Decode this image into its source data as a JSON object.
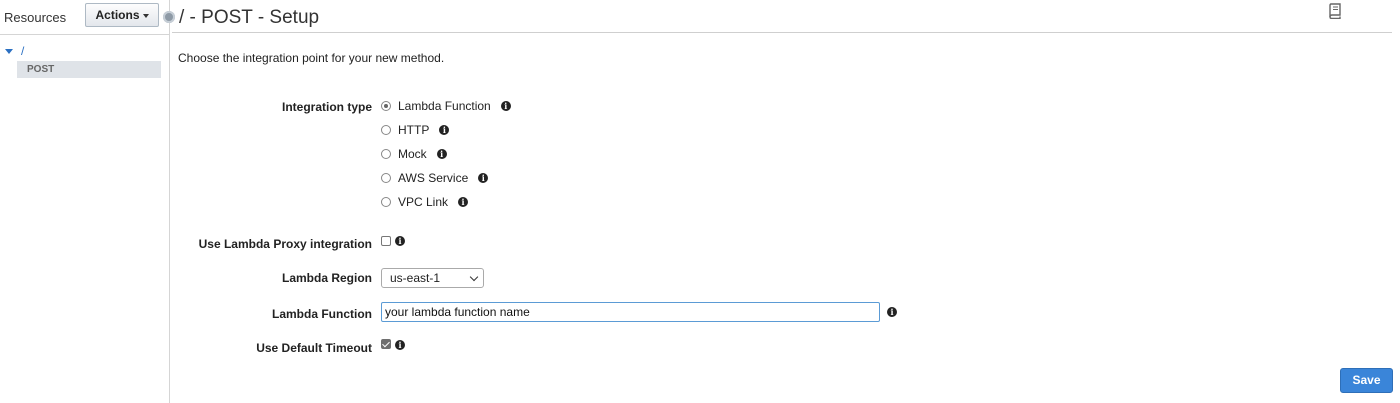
{
  "sidebar": {
    "title": "Resources",
    "actions_label": "Actions",
    "tree": {
      "root_label": "/",
      "child_label": "POST"
    }
  },
  "header": {
    "title": "/ - POST - Setup"
  },
  "main": {
    "intro": "Choose the integration point for your new method.",
    "integration_type": {
      "label": "Integration type",
      "selected": "Lambda Function",
      "options": [
        {
          "label": "Lambda Function"
        },
        {
          "label": "HTTP"
        },
        {
          "label": "Mock"
        },
        {
          "label": "AWS Service"
        },
        {
          "label": "VPC Link"
        }
      ]
    },
    "proxy": {
      "label": "Use Lambda Proxy integration",
      "checked": false
    },
    "region": {
      "label": "Lambda Region",
      "value": "us-east-1"
    },
    "function": {
      "label": "Lambda Function",
      "value": "your lambda function name"
    },
    "timeout": {
      "label": "Use Default Timeout",
      "checked": true
    },
    "save_label": "Save"
  },
  "colors": {
    "accent": "#3a85d9",
    "tree_link": "#2b70c2"
  }
}
